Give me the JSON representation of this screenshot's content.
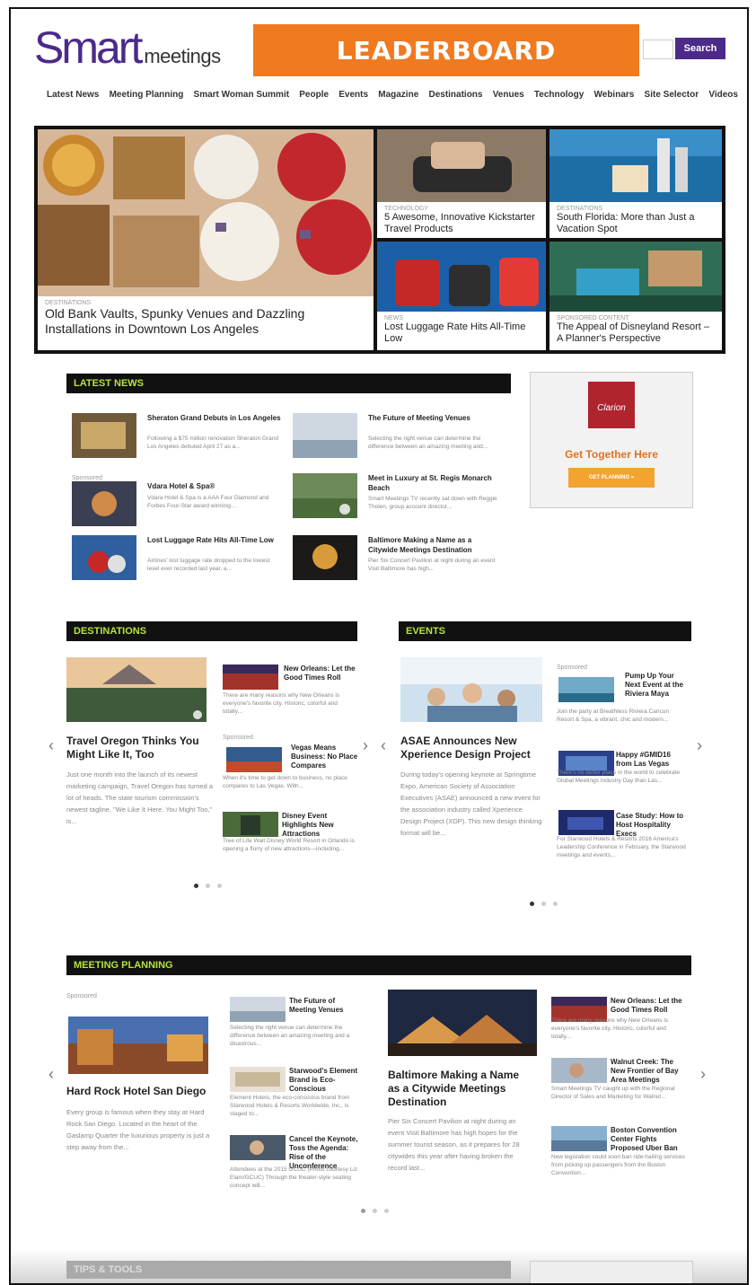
{
  "header": {
    "logo_smart": "Smart",
    "logo_meetings": "meetings",
    "leaderboard": "LEADERBOARD",
    "search_button": "Search"
  },
  "nav": [
    "Latest News",
    "Meeting Planning",
    "Smart Woman Summit",
    "People",
    "Events",
    "Magazine",
    "Destinations",
    "Venues",
    "Technology",
    "Webinars",
    "Site Selector",
    "Videos"
  ],
  "hero": {
    "main": {
      "category": "DESTINATIONS",
      "title": "Old Bank Vaults, Spunky Venues and Dazzling Installations in Downtown Los Angeles"
    },
    "tiles": [
      {
        "category": "TECHNOLOGY",
        "title": "5 Awesome, Innovative Kickstarter Travel Products"
      },
      {
        "category": "DESTINATIONS",
        "title": "South Florida: More than Just a Vacation Spot"
      },
      {
        "category": "NEWS",
        "title": "Lost Luggage Rate Hits All-Time Low"
      },
      {
        "category": "SPONSORED CONTENT",
        "title": "The Appeal of Disneyland Resort – A Planner's Perspective"
      }
    ]
  },
  "latest_news": {
    "header": "LATEST NEWS",
    "sponsored": "Sponsored",
    "items": [
      {
        "title": "Sheraton Grand Debuts in Los Angeles",
        "text": "Following a $75 million renovation Sheraton Grand Los Angeles debuted April 27 as a..."
      },
      {
        "title": "The Future of Meeting Venues",
        "text": "Selecting the right venue can determine the difference between an amazing meeting and..."
      },
      {
        "title": "Vdara Hotel & Spa®",
        "text": "Vdara Hotel & Spa is a AAA Four Diamond and Forbes Four-Star award winning..."
      },
      {
        "title": "Meet in Luxury at St. Regis Monarch Beach",
        "text": "Smart Meetings TV recently sat down with Reggie Tholen, group account director..."
      },
      {
        "title": "Lost Luggage Rate Hits All-Time Low",
        "text": "Airlines' lost luggage rate dropped to the lowest level ever recorded last year, a..."
      },
      {
        "title": "Baltimore Making a Name as a Citywide Meetings Destination",
        "text": "Pier Six Concert Pavilion at night during an event Visit Baltimore has high..."
      }
    ]
  },
  "ad": {
    "logo": "Clarion",
    "headline": "Get Together Here",
    "button": "GET PLANNING »"
  },
  "destinations": {
    "header": "DESTINATIONS",
    "feature": {
      "title": "Travel Oregon Thinks You Might Like It, Too",
      "text": "Just one month into the launch of its newest marketing campaign, Travel Oregon has turned a lot of heads. The state tourism commission's newest tagline, \"We Like It Here. You Might Too,\" is..."
    },
    "sponsored": "Sponsored",
    "items": [
      {
        "title": "New Orleans: Let the Good Times Roll",
        "text": "There are many reasons why New Orleans is everyone's favorite city. Historic, colorful and totally..."
      },
      {
        "title": "Vegas Means Business: No Place Compares",
        "text": "When it's time to get down to business, no place compares to Las Vegas. With..."
      },
      {
        "title": "Disney Event Highlights New Attractions",
        "text": "Tree of Life Walt Disney World Resort in Orlando is opening a flurry of new attractions—including..."
      }
    ]
  },
  "events": {
    "header": "EVENTS",
    "feature": {
      "title": "ASAE Announces New Xperience Design Project",
      "text": "During today's opening keynote at Springtime Expo, American Society of Association Executives (ASAE) announced a new event for the association industry called Xperience Design Project (XDP). This new design thinking format will be..."
    },
    "sponsored": "Sponsored",
    "items": [
      {
        "title": "Pump Up Your Next Event at the Riviera Maya",
        "text": "Join the party at Breathless Riviera Cancun Resort & Spa, a vibrant, chic and modern..."
      },
      {
        "title": "Happy #GMID16 from Las Vegas",
        "text": "There's no better place in the world to celebrate Global Meetings Industry Day than Las..."
      },
      {
        "title": "Case Study: How to Host Hospitality Execs",
        "text": "For Starwood Hotels & Resorts 2016 America's Leadership Conference in February, the Starwood meetings and events..."
      }
    ]
  },
  "meeting_planning": {
    "header": "MEETING PLANNING",
    "sponsored": "Sponsored",
    "feature1": {
      "title": "Hard Rock Hotel San Diego",
      "text": "Every group is famous when they stay at Hard Rock San Diego. Located in the heart of the Gaslamp Quarter the luxurious property is just a step away from the..."
    },
    "feature2": {
      "title": "Baltimore Making a Name as a Citywide Meetings Destination",
      "text": "Pier Six Concert Pavilion at night during an event Visit Baltimore has high hopes for the summer tourist season, as it prepares for 28 citywides this year after having broken the record last..."
    },
    "items_left": [
      {
        "title": "The Future of Meeting Venues",
        "text": "Selecting the right venue can determine the difference between an amazing meeting and a disastrous..."
      },
      {
        "title": "Starwood's Element Brand is Eco-Conscious",
        "text": "Element Hotels, the eco-conscious brand from Starwood Hotels & Resorts Worldwide, Inc., is staged to..."
      },
      {
        "title": "Cancel the Keynote, Toss the Agenda: Rise of the Unconference",
        "text": "Attendees at the 2015 GCUC (Photo courtesy Liz Elam/GCUC) Through the theater-style seating concept will..."
      }
    ],
    "items_right": [
      {
        "title": "New Orleans: Let the Good Times Roll",
        "text": "There are many reasons why New Orleans is everyone's favorite city. Historic, colorful and totally..."
      },
      {
        "title": "Walnut Creek: The New Frontier of Bay Area Meetings",
        "text": "Smart Meetings TV caught up with the Regional Director of Sales and Marketing for Walnut..."
      },
      {
        "title": "Boston Convention Center Fights Proposed Uber Ban",
        "text": "New legislation could soon ban ride-hailing services from picking up passengers from the Boston Convention..."
      }
    ]
  },
  "tips": {
    "header": "TIPS & TOOLS"
  },
  "colors": {
    "brand_purple": "#4b2a8a",
    "leaderboard_orange": "#f07a20",
    "section_green": "#b6e53a"
  }
}
